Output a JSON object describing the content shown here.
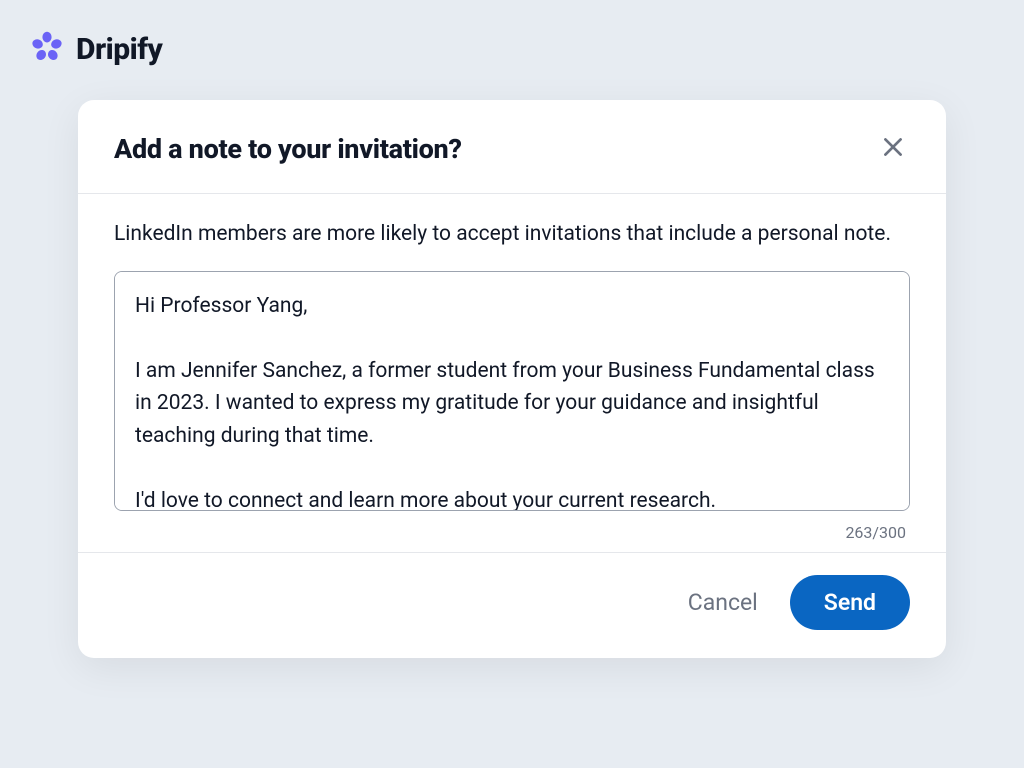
{
  "brand": {
    "name": "Dripify"
  },
  "modal": {
    "title": "Add a note to your invitation?",
    "helper": "LinkedIn members are more likely to accept invitations that include a personal note.",
    "note_value": "Hi Professor Yang,\n\nI am Jennifer Sanchez, a former student from your Business Fundamental class in 2023. I wanted to express my gratitude for your guidance and insightful teaching during that time.\n\nI'd love to connect and learn more about your current research.",
    "counter": "263/300",
    "cancel_label": "Cancel",
    "send_label": "Send"
  }
}
